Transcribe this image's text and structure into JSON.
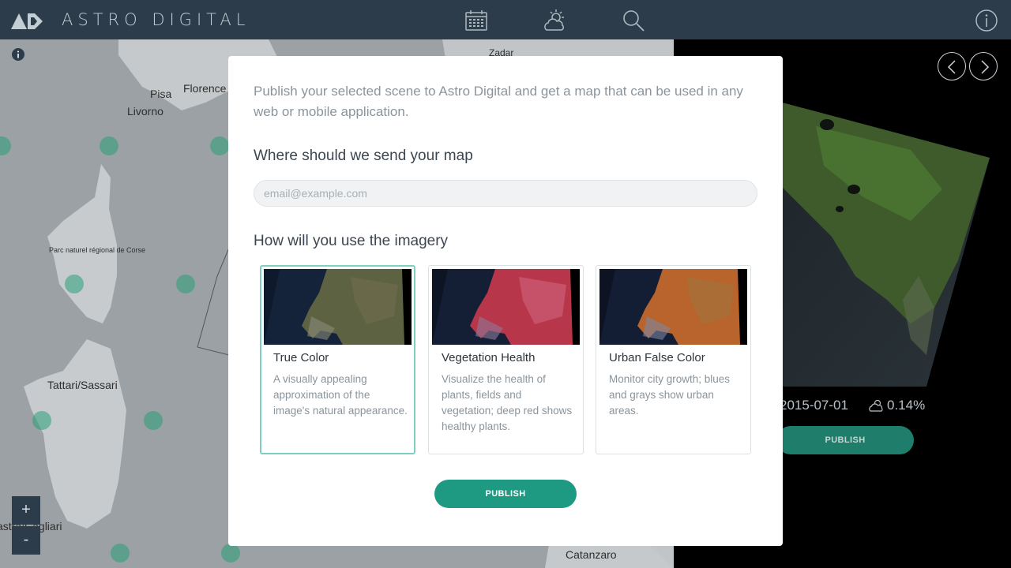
{
  "app": {
    "brand": "ASTRO DIGITAL"
  },
  "nav": {
    "icons": [
      "calendar-icon",
      "weather-icon",
      "search-icon",
      "info-icon"
    ]
  },
  "map": {
    "places": [
      {
        "name": "Pisa",
        "class": ""
      },
      {
        "name": "Florence",
        "class": ""
      },
      {
        "name": "Livorno",
        "class": ""
      },
      {
        "name": "Zadar",
        "class": ""
      },
      {
        "name": "Tattari/Sassari",
        "class": ""
      },
      {
        "name": "astra/Cagliari",
        "class": ""
      },
      {
        "name": "Catanzaro",
        "class": ""
      },
      {
        "name": "Parc naturel régional de Corse",
        "class": "small"
      }
    ],
    "zoom_in": "+",
    "zoom_out": "-"
  },
  "scene": {
    "date": "2015-07-01",
    "cloud_cover": "0.14%",
    "publish_label": "PUBLISH"
  },
  "modal": {
    "intro": "Publish your selected scene to Astro Digital and get a map that can be used in any web or mobile application.",
    "send_heading": "Where should we send your map",
    "email_placeholder": "email@example.com",
    "email_value": "",
    "use_heading": "How will you use the imagery",
    "options": [
      {
        "title": "True Color",
        "description": "A visually appealing approximation of the image's natural appearance.",
        "selected": true
      },
      {
        "title": "Vegetation Health",
        "description": "Visualize the health of plants, fields and vegetation; deep red shows healthy plants.",
        "selected": false
      },
      {
        "title": "Urban False Color",
        "description": "Monitor city growth; blues and grays show urban areas.",
        "selected": false
      }
    ],
    "publish_label": "PUBLISH"
  },
  "colors": {
    "topbar": "#2c3c4a",
    "accent": "#1f9a82",
    "selected_border": "#7ecfbf"
  }
}
